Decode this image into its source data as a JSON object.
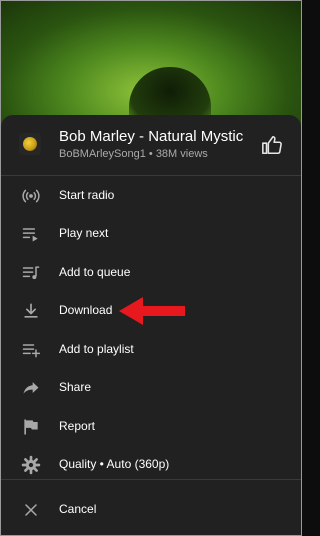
{
  "video": {
    "title": "Bob Marley - Natural Mystic",
    "channel": "BoBMArleySong1",
    "views": "38M views",
    "separator": "•"
  },
  "menu": {
    "items": [
      {
        "icon": "radio-icon",
        "label": "Start radio"
      },
      {
        "icon": "play-next-icon",
        "label": "Play next"
      },
      {
        "icon": "add-to-queue-icon",
        "label": "Add to queue"
      },
      {
        "icon": "download-icon",
        "label": "Download"
      },
      {
        "icon": "add-to-playlist-icon",
        "label": "Add to playlist"
      },
      {
        "icon": "share-icon",
        "label": "Share"
      },
      {
        "icon": "flag-icon",
        "label": "Report"
      },
      {
        "icon": "gear-icon",
        "label": "Quality • Auto (360p)"
      }
    ],
    "cancel": {
      "icon": "close-icon",
      "label": "Cancel"
    }
  },
  "colors": {
    "sheet": "#212121",
    "text": "#ffffff",
    "secondary": "#aaaaaa",
    "icon": "#a8a8a8",
    "annotation_arrow": "#e8191e"
  }
}
